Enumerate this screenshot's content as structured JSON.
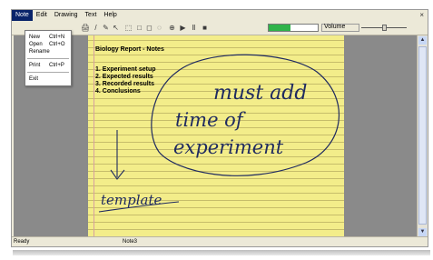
{
  "menubar": {
    "items": [
      "Note",
      "Edit",
      "Drawing",
      "Text",
      "Help"
    ],
    "close": "×"
  },
  "file_menu": {
    "items": [
      {
        "label": "New",
        "shortcut": "Ctrl+N"
      },
      {
        "label": "Open",
        "shortcut": "Ctrl+O"
      },
      {
        "label": "Rename",
        "shortcut": ""
      },
      {
        "label": "Print",
        "shortcut": "Ctrl+P"
      },
      {
        "label": "Exit",
        "shortcut": ""
      }
    ]
  },
  "toolbar": {
    "icons": [
      "print-icon",
      "pen-icon",
      "brush-icon",
      "pointer-icon",
      "select-icon",
      "shape-icon",
      "eraser-icon",
      "lasso-icon",
      "record-icon",
      "play-icon",
      "pause-icon",
      "stop-icon"
    ],
    "glyphs": [
      "🖨",
      "/",
      "✎",
      "↖",
      "⬚",
      "□",
      "◻",
      "◌",
      "⊕",
      "▶",
      "Ⅱ",
      "■"
    ],
    "progress": 0.45,
    "progress_color": "#2fb34a",
    "volume_label": "Volume",
    "volume_level": 0.5
  },
  "note": {
    "title": "Biology Report - Notes",
    "list": [
      "1. Experiment setup",
      "2. Expected results",
      "3. Recorded results",
      "4. Conclusions"
    ],
    "handwriting": {
      "line1": "must add",
      "line2": "time of",
      "line3": "experiment",
      "label": "template"
    },
    "paper_color": "#f3ed8a"
  },
  "statusbar": {
    "ready": "Ready",
    "note_name": "Note3"
  }
}
